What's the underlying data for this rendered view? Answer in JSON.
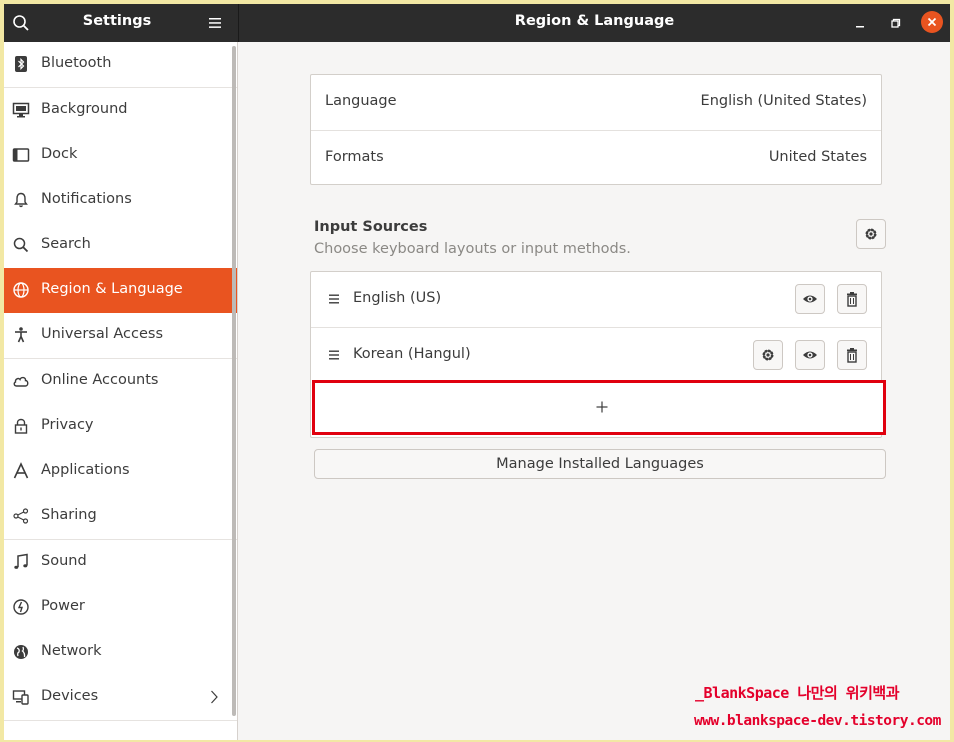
{
  "header": {
    "sidebar_title": "Settings",
    "title": "Region & Language"
  },
  "sidebar": {
    "items": [
      {
        "label": "Bluetooth",
        "icon": "bluetooth-icon"
      },
      {
        "label": "Background",
        "icon": "monitor-icon"
      },
      {
        "label": "Dock",
        "icon": "dock-icon"
      },
      {
        "label": "Notifications",
        "icon": "bell-icon"
      },
      {
        "label": "Search",
        "icon": "search-icon"
      },
      {
        "label": "Region & Language",
        "icon": "globe-icon",
        "active": true
      },
      {
        "label": "Universal Access",
        "icon": "accessibility-icon"
      },
      {
        "label": "Online Accounts",
        "icon": "cloud-icon"
      },
      {
        "label": "Privacy",
        "icon": "lock-icon"
      },
      {
        "label": "Applications",
        "icon": "applications-icon"
      },
      {
        "label": "Sharing",
        "icon": "share-icon"
      },
      {
        "label": "Sound",
        "icon": "music-note-icon"
      },
      {
        "label": "Power",
        "icon": "power-icon"
      },
      {
        "label": "Network",
        "icon": "network-globe-icon"
      },
      {
        "label": "Devices",
        "icon": "devices-icon"
      }
    ]
  },
  "region": {
    "language_label": "Language",
    "language_value": "English (United States)",
    "formats_label": "Formats",
    "formats_value": "United States"
  },
  "input_sources": {
    "title": "Input Sources",
    "subtitle": "Choose keyboard layouts or input methods.",
    "sources": [
      {
        "name": "English (US)"
      },
      {
        "name": "Korean (Hangul)"
      }
    ],
    "add_label": "+"
  },
  "manage_button": "Manage Installed Languages",
  "watermark": {
    "line1": "_BlankSpace 나만의 위키백과",
    "line2": "www.blankspace-dev.tistory.com"
  },
  "colors": {
    "accent": "#e95420",
    "highlight_border": "#e0000e",
    "headerbar": "#2c2c2c",
    "watermark": "#e4002b"
  }
}
